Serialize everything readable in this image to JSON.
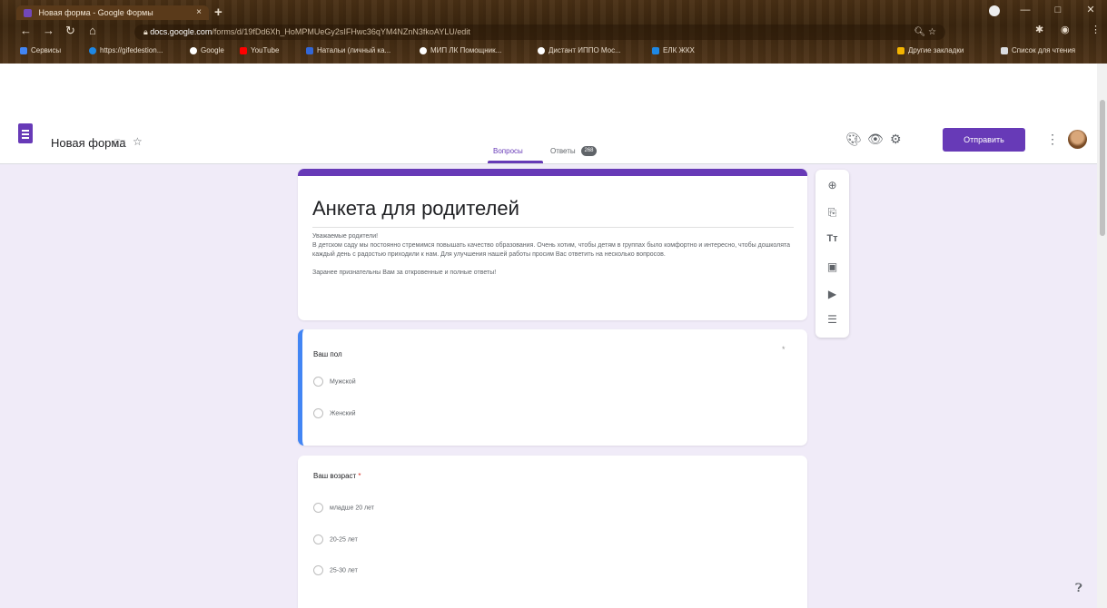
{
  "browser": {
    "tab_title": "Новая форма - Google Формы",
    "tab_close": "×",
    "new_tab": "+",
    "window_buttons": [
      "—",
      "□",
      "✕"
    ],
    "url_host": "docs.google.com",
    "url_path": "/forms/d/19fDd6Xh_HoMPMUeGy2sIFHwc36qYM4NZnN3fkoAYLU/edit",
    "bookmarks": [
      {
        "label": "Сервисы",
        "color": "#4285f4"
      },
      {
        "label": "https://gifedestion...",
        "color": "#1e88e5"
      },
      {
        "label": "Google",
        "color": "#ffffff"
      },
      {
        "label": "YouTube",
        "color": "#ff0000"
      },
      {
        "label": "Натальи (личный ка...",
        "color": "#3367d6"
      },
      {
        "label": "МИП ЛК Помощник...",
        "color": "#ffffff"
      },
      {
        "label": "Дистант ИППО Мос...",
        "color": "#ffffff"
      },
      {
        "label": "ЕЛК ЖКХ",
        "color": "#1e88e5"
      }
    ],
    "bookmarks_other": "Другие закладки",
    "reading_list": "Список для чтения"
  },
  "header": {
    "form_name": "Новая форма",
    "send_label": "Отправить",
    "tabs": {
      "questions": "Вопросы",
      "responses": "Ответы",
      "responses_count": "268"
    }
  },
  "form": {
    "title": "Анкета для родителей",
    "description": [
      "Уважаемые родители!",
      "В детском саду мы постоянно стремимся повышать качество образования. Очень хотим, чтобы детям в группах было комфортно и интересно, чтобы дошколята каждый день с радостью приходили к нам. Для улучшения нашей работы просим Вас ответить на несколько вопросов.",
      "",
      "Заранее признательны Вам за откровенные и полные ответы!"
    ],
    "questions": [
      {
        "title": "Ваш пол",
        "required": "*",
        "options": [
          "Мужской",
          "Женский"
        ]
      },
      {
        "title": "Ваш возраст",
        "required": "*",
        "options": [
          "младше 20 лет",
          "20-25 лет",
          "25-30 лет"
        ]
      }
    ]
  },
  "toolbar_icons": [
    "add-question-icon",
    "import-questions-icon",
    "add-title-icon",
    "add-image-icon",
    "add-video-icon",
    "add-section-icon"
  ]
}
